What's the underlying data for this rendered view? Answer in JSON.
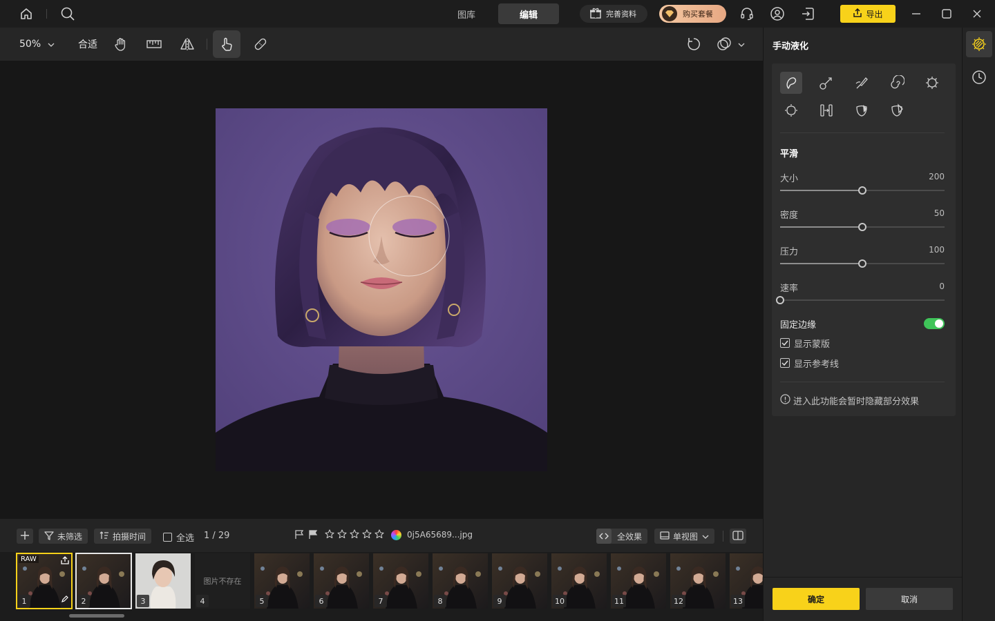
{
  "titlebar": {
    "tabs": [
      {
        "label": "图库",
        "active": false
      },
      {
        "label": "编辑",
        "active": true
      }
    ],
    "complete_profile_label": "完善资料",
    "buy_plan_label": "购买套餐",
    "export_label": "导出",
    "icons": [
      "home-icon",
      "search-icon",
      "gift-icon",
      "headset-icon",
      "user-icon",
      "logout-icon",
      "minimize-icon",
      "maximize-icon",
      "close-icon"
    ],
    "accent_color": "#f8d21a"
  },
  "toolbar": {
    "zoom_value": "50%",
    "fit_label": "合适",
    "tools": [
      "hand-icon",
      "ruler-icon",
      "flip-icon",
      "touch-icon",
      "bandage-icon"
    ],
    "right_tools": [
      "rotate-icon",
      "compare-icon"
    ]
  },
  "filmbar": {
    "filter_label": "未筛选",
    "sort_label": "拍摄时间",
    "select_all_label": "全选",
    "page_indicator": "1 / 29",
    "filename": "0j5A65689...jpg",
    "rating_stars": 0,
    "all_effects_label": "全效果",
    "view_mode_label": "单视图"
  },
  "filmstrip": {
    "thumbs": [
      {
        "num": "1",
        "badge": "RAW",
        "state": "current"
      },
      {
        "num": "2",
        "badge": "",
        "state": "selected"
      },
      {
        "num": "3",
        "badge": "",
        "state": "normal"
      },
      {
        "num": "4",
        "badge": "",
        "state": "missing",
        "missing_text": "图片不存在"
      },
      {
        "num": "5",
        "badge": "",
        "state": "normal"
      },
      {
        "num": "6",
        "badge": "",
        "state": "normal"
      },
      {
        "num": "7",
        "badge": "",
        "state": "normal"
      },
      {
        "num": "8",
        "badge": "",
        "state": "normal"
      },
      {
        "num": "9",
        "badge": "",
        "state": "normal"
      },
      {
        "num": "10",
        "badge": "",
        "state": "normal"
      },
      {
        "num": "11",
        "badge": "",
        "state": "normal"
      },
      {
        "num": "12",
        "badge": "",
        "state": "normal"
      },
      {
        "num": "13",
        "badge": "",
        "state": "normal"
      }
    ]
  },
  "panel": {
    "title": "手动液化",
    "section_title": "平滑",
    "sliders": [
      {
        "label": "大小",
        "value": "200",
        "fraction": 0.5
      },
      {
        "label": "密度",
        "value": "50",
        "fraction": 0.5
      },
      {
        "label": "压力",
        "value": "100",
        "fraction": 0.5
      },
      {
        "label": "速率",
        "value": "0",
        "fraction": 0.0
      }
    ],
    "fixed_edges_label": "固定边缘",
    "fixed_edges_on": true,
    "show_mask_label": "显示蒙版",
    "show_guides_label": "显示参考线",
    "note": "进入此功能会暂时隐藏部分效果",
    "confirm_label": "确定",
    "cancel_label": "取消",
    "toggle_color": "#3fc459"
  }
}
